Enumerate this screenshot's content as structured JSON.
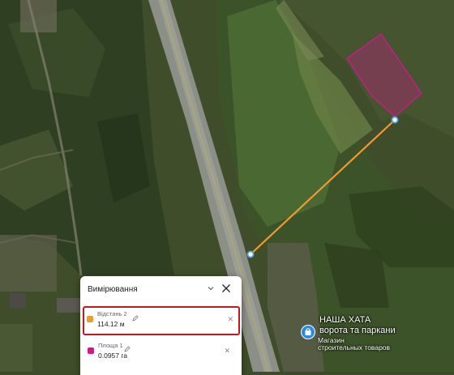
{
  "panel": {
    "title": "Вимірювання",
    "items": [
      {
        "label": "Відстань 2",
        "value": "114.12 м",
        "color": "#f29a2e",
        "selected": true
      },
      {
        "label": "Площа 1",
        "value": "0.0957 га",
        "color": "#d4188c",
        "selected": false
      }
    ]
  },
  "poi": {
    "title": "НАША ХАТА",
    "subtitle": "ворота та паркани",
    "category_line1": "Магазин",
    "category_line2": "строительных товаров"
  },
  "colors": {
    "measure_line": "#f29a2e",
    "polygon": "#d4188c",
    "highlight_border": "#c7161d",
    "endpoint": "#4aa0e6"
  },
  "icons": [
    "shopping-bag-icon",
    "pencil-icon",
    "close-icon",
    "chevron-down-icon"
  ]
}
